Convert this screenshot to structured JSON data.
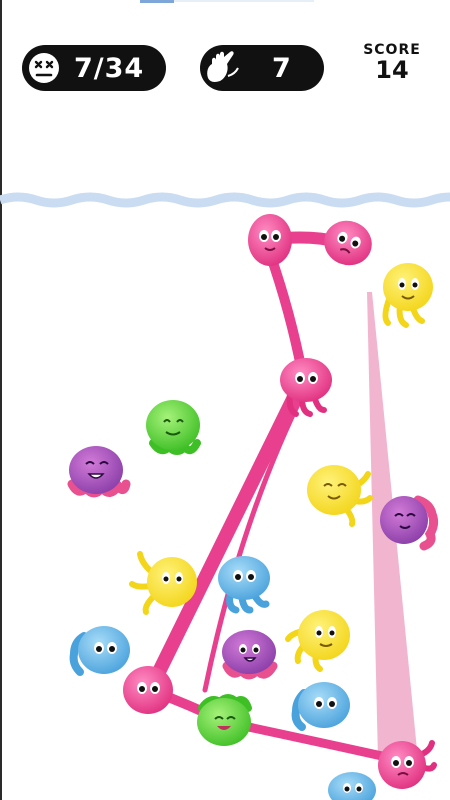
{
  "hud": {
    "lives_icon": "dead-face-icon",
    "lives_text": "7/34",
    "moves_icon": "hand-swipe-icon",
    "moves_text": "7",
    "score_label": "SCORE",
    "score_value": "14"
  },
  "colors": {
    "pink": "#e8408f",
    "yellow": "#f6e12b",
    "green": "#53d12f",
    "blue": "#5ab1e6",
    "purple": "#a05ab6",
    "water_line": "#c9dcf2",
    "tentacle": "#e8408f",
    "hint_beam": "#f0a8c8"
  }
}
